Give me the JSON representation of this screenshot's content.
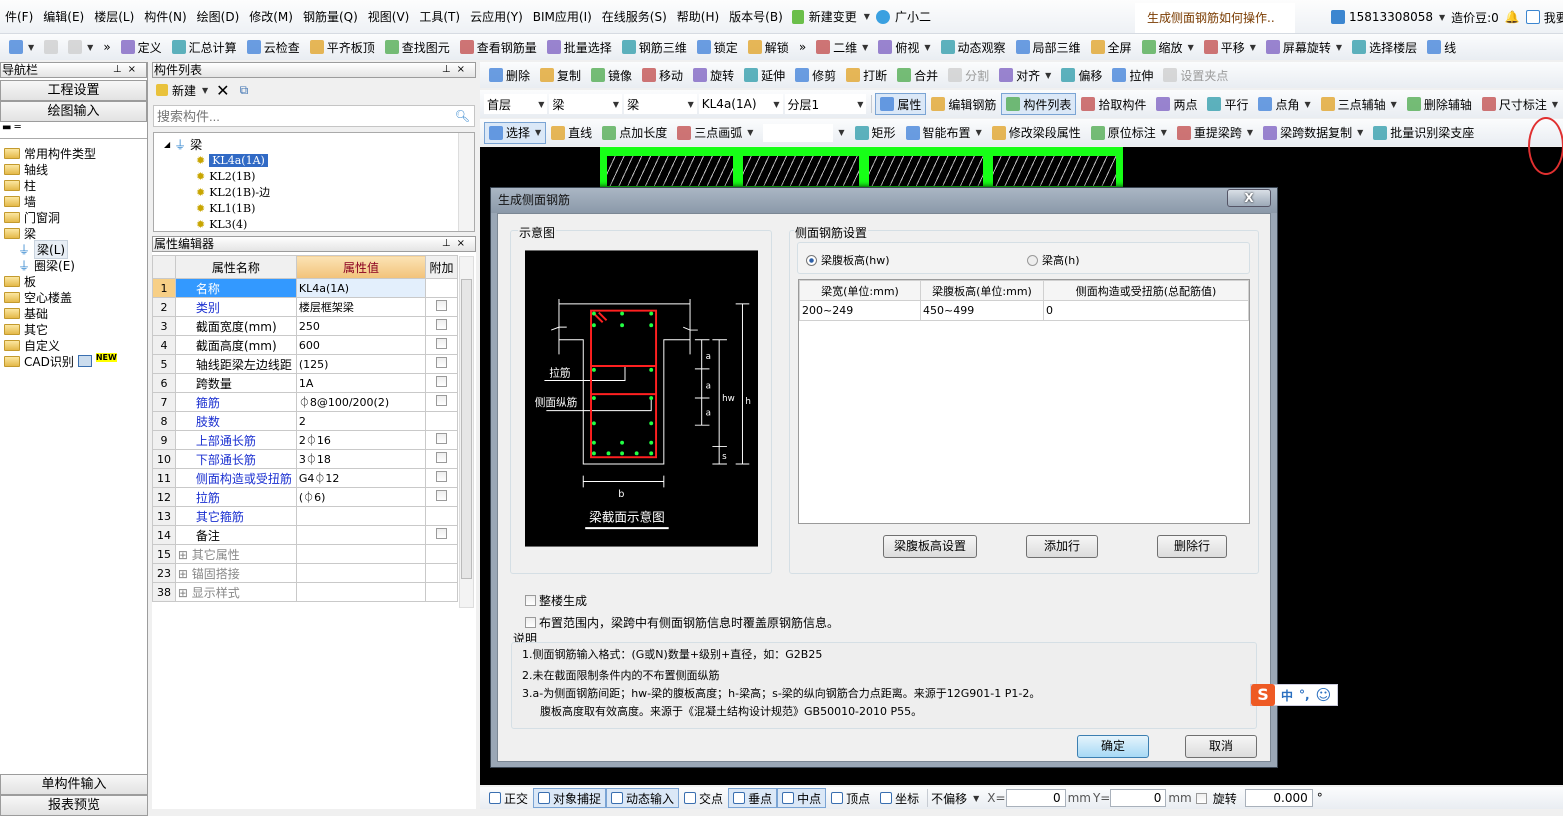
{
  "menubar": {
    "items": [
      "件(F)",
      "编辑(E)",
      "楼层(L)",
      "构件(N)",
      "绘图(D)",
      "修改(M)",
      "钢筋量(Q)",
      "视图(V)",
      "工具(T)",
      "云应用(Y)",
      "BIM应用(I)",
      "在线服务(S)",
      "帮助(H)",
      "版本号(B)"
    ],
    "new_change": "新建变更",
    "assistant": "广小二",
    "help_search": "生成侧面钢筋如何操作..",
    "account": "15813308058",
    "beans": "造价豆:0",
    "feedback": "我要建"
  },
  "toolbar_main": [
    {
      "label": "",
      "icon": "open-folder",
      "dropdown": true
    },
    {
      "label": "",
      "icon": "save",
      "disabled": true
    },
    {
      "label": "",
      "icon": "undo",
      "dropdown": true,
      "disabled": true
    },
    {
      "label": "»",
      "icon": "overflow"
    },
    {
      "label": "定义",
      "icon": "define"
    },
    {
      "label": "汇总计算",
      "icon": "sigma"
    },
    {
      "label": "云检查",
      "icon": "cloud-check"
    },
    {
      "label": "平齐板顶",
      "icon": "align-slab"
    },
    {
      "label": "查找图元",
      "icon": "binoculars"
    },
    {
      "label": "查看钢筋量",
      "icon": "glasses"
    },
    {
      "label": "批量选择",
      "icon": "batch-select"
    },
    {
      "label": "钢筋三维",
      "icon": "rebar-3d"
    },
    {
      "label": "锁定",
      "icon": "lock"
    },
    {
      "label": "解锁",
      "icon": "unlock"
    },
    {
      "label": "»",
      "icon": "overflow"
    },
    {
      "label": "二维",
      "icon": "2d",
      "dropdown": true
    },
    {
      "label": "俯视",
      "icon": "top-view",
      "dropdown": true
    },
    {
      "label": "动态观察",
      "icon": "orbit"
    },
    {
      "label": "局部三维",
      "icon": "local-3d"
    },
    {
      "label": "全屏",
      "icon": "fullscreen"
    },
    {
      "label": "缩放",
      "icon": "zoom",
      "dropdown": true
    },
    {
      "label": "平移",
      "icon": "pan-hand",
      "dropdown": true
    },
    {
      "label": "屏幕旋转",
      "icon": "rotate-screen",
      "dropdown": true
    },
    {
      "label": "选择楼层",
      "icon": "select-floor"
    },
    {
      "label": "线",
      "icon": "wireframe"
    }
  ],
  "toolbar_edit": [
    {
      "label": "删除",
      "icon": "delete"
    },
    {
      "label": "复制",
      "icon": "copy"
    },
    {
      "label": "镜像",
      "icon": "mirror"
    },
    {
      "label": "移动",
      "icon": "move"
    },
    {
      "label": "旋转",
      "icon": "rotate"
    },
    {
      "label": "延伸",
      "icon": "extend"
    },
    {
      "label": "修剪",
      "icon": "trim"
    },
    {
      "label": "打断",
      "icon": "break"
    },
    {
      "label": "合并",
      "icon": "merge"
    },
    {
      "label": "分割",
      "icon": "split",
      "disabled": true
    },
    {
      "label": "对齐",
      "icon": "align",
      "dropdown": true
    },
    {
      "label": "偏移",
      "icon": "offset"
    },
    {
      "label": "拉伸",
      "icon": "stretch"
    },
    {
      "label": "设置夹点",
      "icon": "grip",
      "disabled": true
    }
  ],
  "toolbar_props": {
    "selects": [
      "首层",
      "梁",
      "梁",
      "KL4a(1A)",
      "分层1"
    ],
    "items": [
      {
        "label": "属性",
        "icon": "properties",
        "active": true
      },
      {
        "label": "编辑钢筋",
        "icon": "edit-rebar"
      },
      {
        "label": "构件列表",
        "icon": "component-list",
        "active": true
      },
      {
        "label": "拾取构件",
        "icon": "pick"
      },
      {
        "label": "两点",
        "icon": "two-point"
      },
      {
        "label": "平行",
        "icon": "parallel"
      },
      {
        "label": "点角",
        "icon": "point-angle",
        "dropdown": true
      },
      {
        "label": "三点辅轴",
        "icon": "three-point-axis",
        "dropdown": true
      },
      {
        "label": "删除辅轴",
        "icon": "delete-axis"
      },
      {
        "label": "尺寸标注",
        "icon": "dimension",
        "dropdown": true
      }
    ]
  },
  "toolbar_draw": [
    {
      "label": "选择",
      "icon": "select-cursor",
      "dropdown": true,
      "active": true
    },
    {
      "label": "直线",
      "icon": "line"
    },
    {
      "label": "点加长度",
      "icon": "point-length"
    },
    {
      "label": "三点画弧",
      "icon": "arc",
      "dropdown": true
    },
    {
      "label": "",
      "icon": "blank-select",
      "dropdown": true
    },
    {
      "label": "矩形",
      "icon": "rectangle"
    },
    {
      "label": "智能布置",
      "icon": "smart-layout",
      "dropdown": true
    },
    {
      "label": "修改梁段属性",
      "icon": "modify-segment"
    },
    {
      "label": "原位标注",
      "icon": "in-place-label",
      "dropdown": true
    },
    {
      "label": "重提梁跨",
      "icon": "respan",
      "dropdown": true
    },
    {
      "label": "梁跨数据复制",
      "icon": "copy-span",
      "dropdown": true
    },
    {
      "label": "批量识别梁支座",
      "icon": "identify-support"
    }
  ],
  "nav": {
    "title": "导航栏",
    "project_settings": "工程设置",
    "drawing_input": "绘图输入",
    "tree": [
      {
        "label": "常用构件类型"
      },
      {
        "label": "轴线"
      },
      {
        "label": "柱"
      },
      {
        "label": "墙"
      },
      {
        "label": "门窗洞"
      },
      {
        "label": "梁",
        "expanded": true
      },
      {
        "label": "梁(L)",
        "child": true,
        "selected": true
      },
      {
        "label": "圈梁(E)",
        "child": true
      },
      {
        "label": "板"
      },
      {
        "label": "空心楼盖"
      },
      {
        "label": "基础"
      },
      {
        "label": "其它"
      },
      {
        "label": "自定义"
      },
      {
        "label": "CAD识别",
        "badge": "NEW"
      }
    ],
    "single_input": "单构件输入",
    "report_preview": "报表预览"
  },
  "component_list": {
    "title": "构件列表",
    "new_label": "新建",
    "search_placeholder": "搜索构件...",
    "root": "梁",
    "items": [
      "KL4a(1A)",
      "KL2(1B)",
      "KL2(1B)-边",
      "KL1(1B)",
      "KL3(4)"
    ],
    "selected_index": 0
  },
  "property_editor": {
    "title": "属性编辑器",
    "headers": [
      "属性名称",
      "属性值",
      "附加"
    ],
    "rows": [
      {
        "no": "1",
        "name": "名称",
        "value": "KL4a(1A)",
        "style": "selected",
        "check": false
      },
      {
        "no": "2",
        "name": "类别",
        "value": "楼层框架梁",
        "style": "blue",
        "check": true
      },
      {
        "no": "3",
        "name": "截面宽度(mm)",
        "value": "250",
        "style": "black",
        "check": true
      },
      {
        "no": "4",
        "name": "截面高度(mm)",
        "value": "600",
        "style": "black",
        "check": true
      },
      {
        "no": "5",
        "name": "轴线距梁左边线距",
        "value": "(125)",
        "style": "black",
        "check": true
      },
      {
        "no": "6",
        "name": "跨数量",
        "value": "1A",
        "style": "black",
        "check": true
      },
      {
        "no": "7",
        "name": "箍筋",
        "value": "⏀8@100/200(2)",
        "style": "blue",
        "check": true
      },
      {
        "no": "8",
        "name": "肢数",
        "value": "2",
        "style": "blue",
        "check": false
      },
      {
        "no": "9",
        "name": "上部通长筋",
        "value": "2⏀16",
        "style": "blue",
        "check": true
      },
      {
        "no": "10",
        "name": "下部通长筋",
        "value": "3⏀18",
        "style": "blue",
        "check": true
      },
      {
        "no": "11",
        "name": "侧面构造或受扭筋",
        "value": "G4⏀12",
        "style": "blue",
        "check": true
      },
      {
        "no": "12",
        "name": "拉筋",
        "value": "(⏀6)",
        "style": "blue",
        "check": true
      },
      {
        "no": "13",
        "name": "其它箍筋",
        "value": "",
        "style": "blue",
        "check": false
      },
      {
        "no": "14",
        "name": "备注",
        "value": "",
        "style": "black",
        "check": true
      },
      {
        "no": "15",
        "name": "其它属性",
        "value": "",
        "style": "group",
        "check": false
      },
      {
        "no": "23",
        "name": "锚固搭接",
        "value": "",
        "style": "group",
        "check": false
      },
      {
        "no": "38",
        "name": "显示样式",
        "value": "",
        "style": "group",
        "check": false
      }
    ]
  },
  "dialog": {
    "title": "生成侧面钢筋",
    "close": "X",
    "diagram_group": "示意图",
    "diagram": {
      "tie_bar": "拉筋",
      "side_bar": "侧面纵筋",
      "a": "a",
      "hw": "hw",
      "h": "h",
      "s": "s",
      "b": "b",
      "caption": "梁截面示意图"
    },
    "settings_group": "侧面钢筋设置",
    "radio_web_height": "梁腹板高(hw)",
    "radio_beam_height": "梁高(h)",
    "radio_selected": "web_height",
    "table_headers": [
      "梁宽(单位:mm)",
      "梁腹板高(单位:mm)",
      "侧面构造或受扭筋(总配筋值)"
    ],
    "table_rows": [
      [
        "200~249",
        "450~499",
        "0"
      ]
    ],
    "btn_web_settings": "梁腹板高设置",
    "btn_add_row": "添加行",
    "btn_delete_row": "删除行",
    "check_whole_building": "整楼生成",
    "check_whole_building_checked": false,
    "check_overwrite": "布置范围内，梁跨中有侧面钢筋信息时覆盖原钢筋信息。",
    "check_overwrite_checked": false,
    "notes_label": "说明",
    "notes": [
      "1.侧面钢筋输入格式：(G或N)数量+级别+直径，如：G2B25",
      "2.未在截面限制条件内的不布置侧面纵筋",
      "3.a-为侧面钢筋间距；hw-梁的腹板高度；h-梁高；s-梁的纵向钢筋合力点距离。来源于12G901-1 P1-2。",
      "腹板高度取有效高度。来源于《混凝土结构设计规范》GB50010-2010 P55。"
    ],
    "ok": "确定",
    "cancel": "取消"
  },
  "ime": {
    "mode": "中",
    "punct": "°,"
  },
  "statusbar": {
    "items": [
      {
        "label": "正交",
        "icon": "ortho"
      },
      {
        "label": "对象捕捉",
        "icon": "snap",
        "active": true
      },
      {
        "label": "动态输入",
        "icon": "dynamic-input",
        "active": true
      },
      {
        "label": "交点",
        "icon": "intersection"
      },
      {
        "label": "垂点",
        "icon": "perpendicular",
        "active": true
      },
      {
        "label": "中点",
        "icon": "midpoint",
        "active": true
      },
      {
        "label": "顶点",
        "icon": "vertex"
      },
      {
        "label": "坐标",
        "icon": "coordinate"
      }
    ],
    "offset_mode": "不偏移",
    "x_label": "X=",
    "x_value": "0",
    "unit": "mm",
    "y_label": "Y=",
    "y_value": "0",
    "rotate_label": "旋转",
    "rotate_value": "0.000",
    "degree": "°"
  },
  "colors": {
    "canvas": "#000000",
    "beam": "#17ff17",
    "rebar_outline": "#ff2020",
    "rebar_dot": "#22ff44",
    "selection": "#316ac5",
    "header_value": "#f7cf86"
  }
}
